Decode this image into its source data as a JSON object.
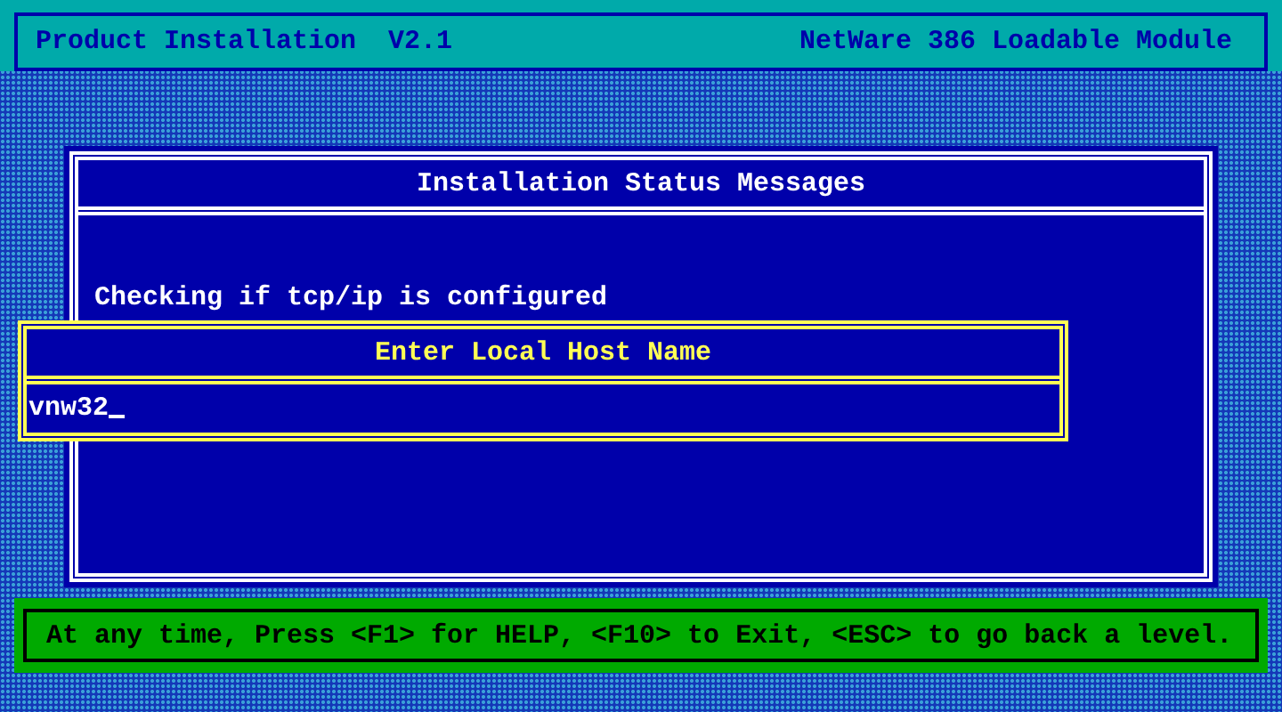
{
  "header": {
    "title": "Product Installation  V2.1",
    "module": "NetWare 386 Loadable Module"
  },
  "status_window": {
    "title": "Installation Status Messages",
    "messages": [
      "Checking if tcp/ip is configured"
    ]
  },
  "dialog": {
    "title": "Enter Local Host Name",
    "value": "vnw32"
  },
  "help_bar": {
    "text": "At any time, Press <F1> for HELP, <F10> to Exit, <ESC> to go back a level."
  }
}
